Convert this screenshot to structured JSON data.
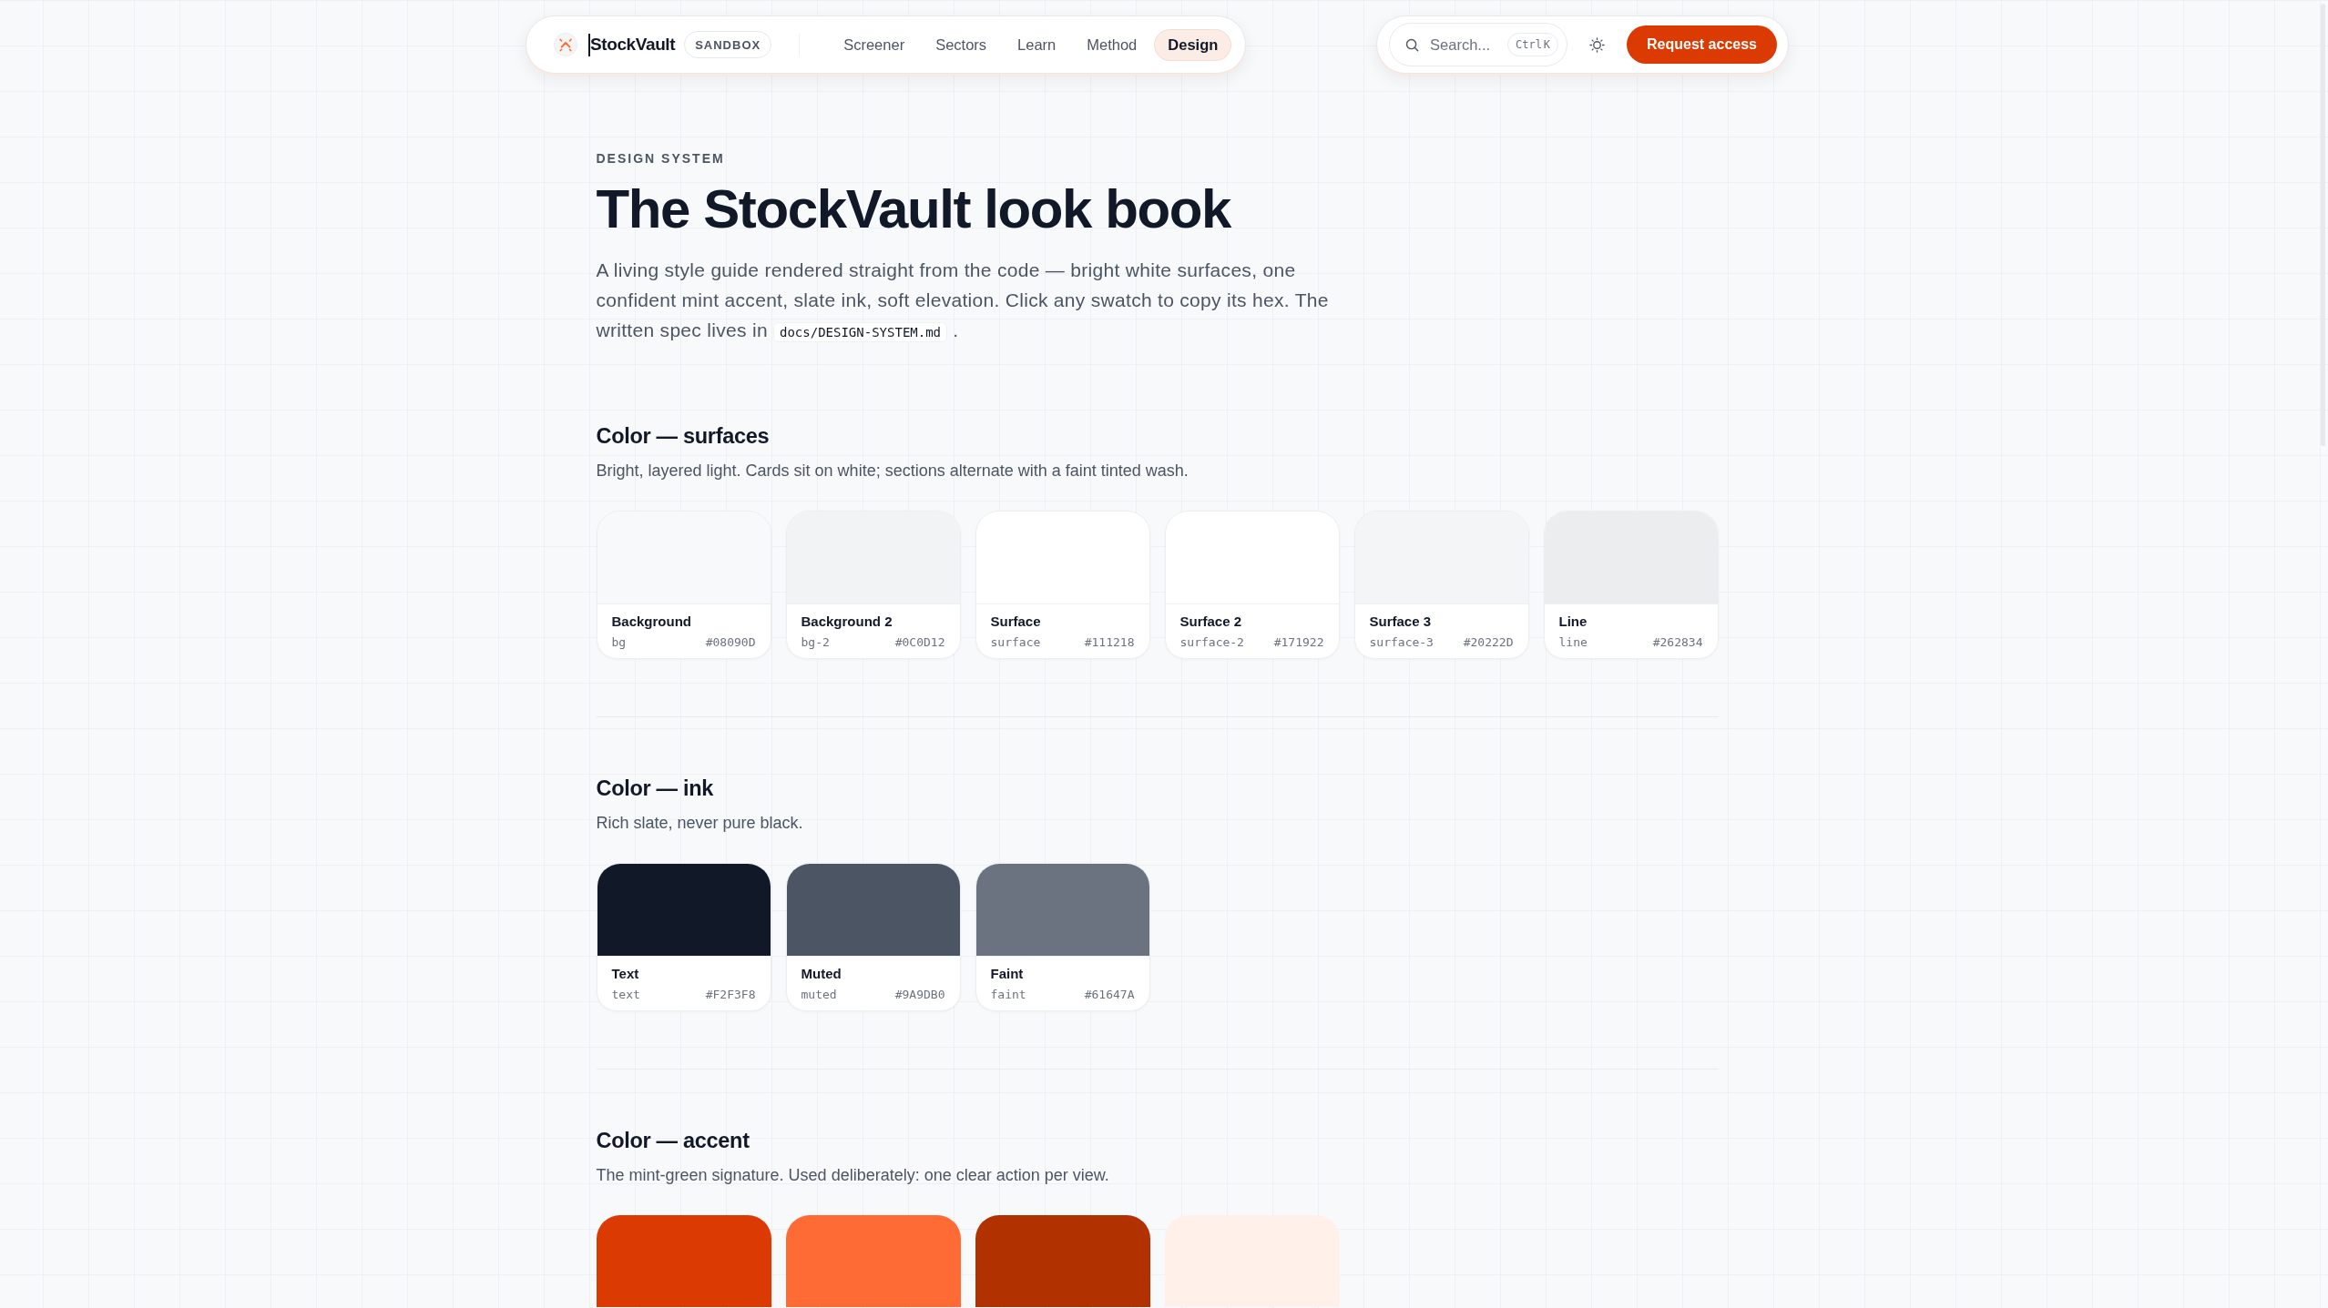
{
  "nav": {
    "brand": "StockVault",
    "badge": "SANDBOX",
    "links": [
      {
        "label": "Screener",
        "selected": false
      },
      {
        "label": "Sectors",
        "selected": false
      },
      {
        "label": "Learn",
        "selected": false
      },
      {
        "label": "Method",
        "selected": false
      },
      {
        "label": "Design",
        "selected": true
      }
    ],
    "search": {
      "placeholder": "Search...",
      "shortcut": "Ctrl K"
    },
    "cta": "Request access"
  },
  "header": {
    "eyebrow": "DESIGN SYSTEM",
    "title": "The StockVault look book",
    "intro": "A living style guide rendered straight from the code — bright white surfaces, one confident mint accent, slate ink, soft elevation. Click any swatch to copy its hex. The written spec lives in",
    "intro_code": "docs/DESIGN-SYSTEM.md",
    "intro_end": "."
  },
  "sections": [
    {
      "title": "Color — surfaces",
      "description": "Bright, layered light. Cards sit on white; sections alternate with a faint tinted wash.",
      "swatches": [
        {
          "name": "Background",
          "token": "bg",
          "hex": "#08090D",
          "color": "#f8f9fa"
        },
        {
          "name": "Background 2",
          "token": "bg-2",
          "hex": "#0C0D12",
          "color": "#f2f3f5"
        },
        {
          "name": "Surface",
          "token": "surface",
          "hex": "#111218",
          "color": "#ffffff"
        },
        {
          "name": "Surface 2",
          "token": "surface-2",
          "hex": "#171922",
          "color": "#ffffff"
        },
        {
          "name": "Surface 3",
          "token": "surface-3",
          "hex": "#20222D",
          "color": "#f4f5f6"
        },
        {
          "name": "Line",
          "token": "line",
          "hex": "#262834",
          "color": "#ecedef"
        }
      ]
    },
    {
      "title": "Color — ink",
      "description": "Rich slate, never pure black.",
      "swatches": [
        {
          "name": "Text",
          "token": "text",
          "hex": "#F2F3F8",
          "color": "#111827"
        },
        {
          "name": "Muted",
          "token": "muted",
          "hex": "#9A9DB0",
          "color": "#4b5563"
        },
        {
          "name": "Faint",
          "token": "faint",
          "hex": "#61647A",
          "color": "#6b7280"
        }
      ]
    },
    {
      "title": "Color — accent",
      "description": "The mint-green signature. Used deliberately: one clear action per view.",
      "swatches": [
        {
          "color": "#db3a03"
        },
        {
          "color": "#ff6b35"
        },
        {
          "color": "#b23100"
        },
        {
          "color": "#fff1ea"
        }
      ]
    }
  ]
}
